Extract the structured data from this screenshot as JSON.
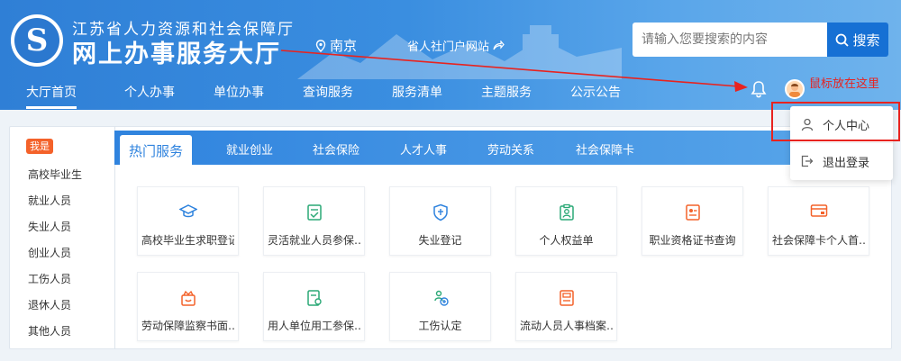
{
  "header": {
    "org_name": "江苏省人力资源和社会保障厅",
    "hall_name": "网上办事服务大厅",
    "city": "南京",
    "portal_link": "省人社门户网站",
    "search_placeholder": "请输入您要搜索的内容",
    "search_button": "搜索",
    "hint_text": "鼠标放在这里"
  },
  "nav": {
    "items": [
      "大厅首页",
      "个人办事",
      "单位办事",
      "查询服务",
      "服务清单",
      "主题服务",
      "公示公告"
    ]
  },
  "user_menu": {
    "items": [
      "个人中心",
      "退出登录"
    ]
  },
  "sidebar": {
    "tag": "我是",
    "items": [
      "高校毕业生",
      "就业人员",
      "失业人员",
      "创业人员",
      "工伤人员",
      "退休人员",
      "其他人员"
    ]
  },
  "tabs": [
    "热门服务",
    "就业创业",
    "社会保险",
    "人才人事",
    "劳动关系",
    "社会保障卡"
  ],
  "services": [
    {
      "label": "高校毕业生求职登记",
      "icon": "graduation-cap-icon"
    },
    {
      "label": "灵活就业人员参保…",
      "icon": "document-check-icon"
    },
    {
      "label": "失业登记",
      "icon": "unemployment-shield-icon"
    },
    {
      "label": "个人权益单",
      "icon": "clipboard-person-icon"
    },
    {
      "label": "职业资格证书查询",
      "icon": "certificate-icon"
    },
    {
      "label": "社会保障卡个人首…",
      "icon": "social-card-icon"
    },
    {
      "label": "劳动保障监察书面…",
      "icon": "gift-box-icon"
    },
    {
      "label": "用人单位用工参保…",
      "icon": "employer-document-icon"
    },
    {
      "label": "工伤认定",
      "icon": "injury-icon"
    },
    {
      "label": "流动人员人事档案…",
      "icon": "archive-icon"
    }
  ],
  "colors": {
    "primary": "#2f83de",
    "accent_orange": "#f4622a",
    "annotation_red": "#e8231f"
  }
}
